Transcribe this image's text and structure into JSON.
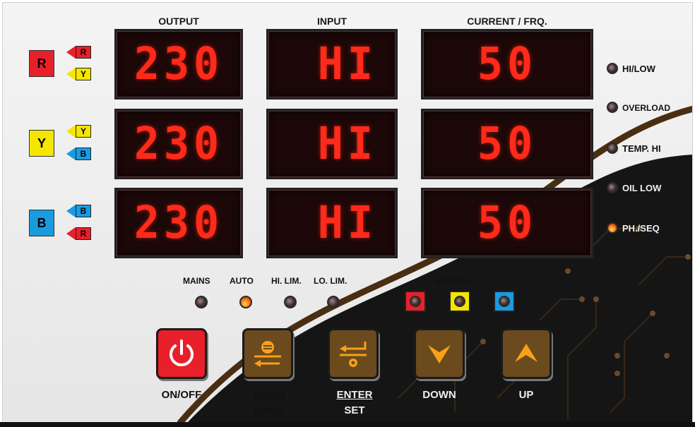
{
  "column_headers": {
    "output": "OUTPUT",
    "input": "INPUT",
    "current": "CURRENT / FRQ."
  },
  "rows": [
    {
      "phase": "R",
      "phase_color": "#e8202a",
      "tags": [
        {
          "text": "R",
          "color": "#e8202a"
        },
        {
          "text": "Y",
          "color": "#f5e600"
        }
      ],
      "output": "230",
      "input": "HI",
      "current": "50"
    },
    {
      "phase": "Y",
      "phase_color": "#f5e600",
      "tags": [
        {
          "text": "Y",
          "color": "#f5e600"
        },
        {
          "text": "B",
          "color": "#1a9be0"
        }
      ],
      "output": "230",
      "input": "HI",
      "current": "50"
    },
    {
      "phase": "B",
      "phase_color": "#1a9be0",
      "tags": [
        {
          "text": "B",
          "color": "#1a9be0"
        },
        {
          "text": "R",
          "color": "#e8202a"
        }
      ],
      "output": "230",
      "input": "HI",
      "current": "50"
    }
  ],
  "status_lamps": [
    {
      "label": "HI/LOW",
      "on": false
    },
    {
      "label": "OVERLOAD",
      "on": false
    },
    {
      "label": "TEMP. HI",
      "on": false
    },
    {
      "label": "OIL LOW",
      "on": false
    },
    {
      "label": "PH./SEQ",
      "on": true
    }
  ],
  "indicators": [
    {
      "label": "MAINS",
      "on": false
    },
    {
      "label": "AUTO",
      "on": true
    },
    {
      "label": "HI. LIM.",
      "on": false
    },
    {
      "label": "LO. LIM.",
      "on": false
    }
  ],
  "manual": {
    "label": "MANUAL",
    "colors": [
      "#e8202a",
      "#f5e600",
      "#1a9be0"
    ]
  },
  "buttons": {
    "onoff": {
      "label": "ON/OFF",
      "color": "#e8202a"
    },
    "menu": {
      "label_top": "MENU",
      "label_bottom": "BACK",
      "color": "#6b4a1e"
    },
    "enter": {
      "label_top": "ENTER",
      "label_bottom": "SET",
      "color": "#6b4a1e"
    },
    "down": {
      "label": "DOWN",
      "color": "#6b4a1e"
    },
    "up": {
      "label": "UP",
      "color": "#6b4a1e"
    }
  },
  "colors": {
    "display_digit": "#ff2a1a",
    "accent_orange": "#f7a11a",
    "wave_brown": "#4a2e12",
    "dark_region": "#141414"
  }
}
